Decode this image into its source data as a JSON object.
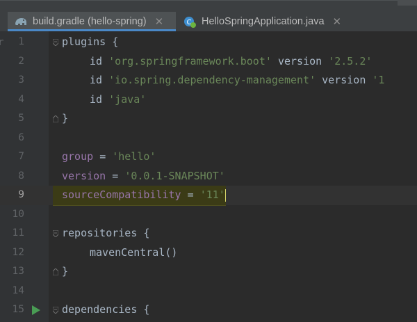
{
  "tabs": [
    {
      "label": "build.gradle (hello-spring)",
      "icon": "gradle-elephant-icon",
      "active": true
    },
    {
      "label": "HelloSpringApplication.java",
      "icon": "spring-boot-class-icon",
      "active": false
    }
  ],
  "left_strip_char": "ri",
  "lines": [
    {
      "num": "1"
    },
    {
      "num": "2"
    },
    {
      "num": "3"
    },
    {
      "num": "4"
    },
    {
      "num": "5"
    },
    {
      "num": "6"
    },
    {
      "num": "7"
    },
    {
      "num": "8"
    },
    {
      "num": "9"
    },
    {
      "num": "10"
    },
    {
      "num": "11"
    },
    {
      "num": "12"
    },
    {
      "num": "13"
    },
    {
      "num": "14"
    },
    {
      "num": "15"
    }
  ],
  "code": {
    "plugins_kw": "plugins",
    "open_brace": "{",
    "close_brace": "}",
    "id_kw": "id",
    "version_kw": "version",
    "plugin1_id": "'org.springframework.boot'",
    "plugin1_ver": "'2.5.2'",
    "plugin2_id": "'io.spring.dependency-management'",
    "plugin2_ver": "'1",
    "plugin3_id": "'java'",
    "group_prop": "group",
    "group_val": "'hello'",
    "version_prop": "version",
    "version_val": "'0.0.1-SNAPSHOT'",
    "source_prop": "sourceCompatibility",
    "source_val": "'11'",
    "equals": "=",
    "repositories_kw": "repositories",
    "maven_call": "mavenCentral()",
    "dependencies_kw": "dependencies"
  },
  "colors": {
    "background": "#2b2b2b",
    "string": "#6a8759",
    "property": "#9876aa",
    "identifier": "#a9b7c6",
    "tab_underline": "#4a88c7",
    "run_gutter": "#499c54"
  }
}
